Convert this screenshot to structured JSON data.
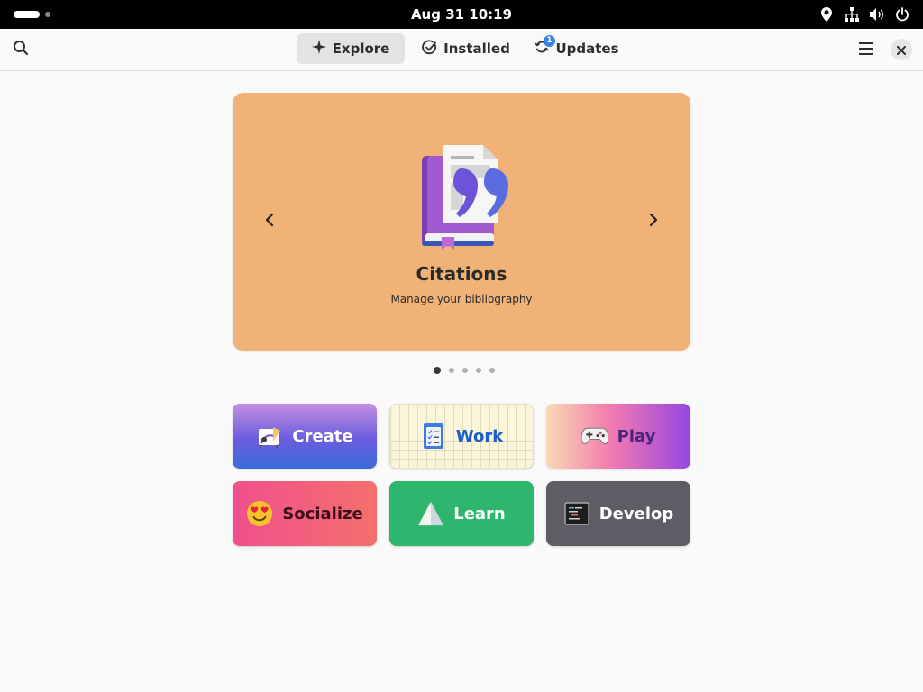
{
  "topbar": {
    "clock": "Aug 31  10:19",
    "tray_icons": [
      "location-icon",
      "network-icon",
      "volume-icon",
      "power-icon"
    ]
  },
  "header": {
    "tabs": [
      {
        "label": "Explore",
        "icon": "sparkle-icon",
        "active": true
      },
      {
        "label": "Installed",
        "icon": "check-circle-icon",
        "active": false
      },
      {
        "label": "Updates",
        "icon": "refresh-icon",
        "active": false,
        "badge": "1"
      }
    ]
  },
  "featured": {
    "title": "Citations",
    "subtitle": "Manage your bibliography",
    "background": "#f0b277",
    "page_count": 5,
    "current_page": 1
  },
  "categories": [
    {
      "label": "Create",
      "icon": "drawing-board-icon"
    },
    {
      "label": "Work",
      "icon": "checklist-icon"
    },
    {
      "label": "Play",
      "icon": "gamepad-icon"
    },
    {
      "label": "Socialize",
      "icon": "heart-eyes-emoji-icon"
    },
    {
      "label": "Learn",
      "icon": "paper-plane-icon"
    },
    {
      "label": "Develop",
      "icon": "terminal-icon"
    }
  ],
  "colors": {
    "accent": "#3584e4"
  }
}
